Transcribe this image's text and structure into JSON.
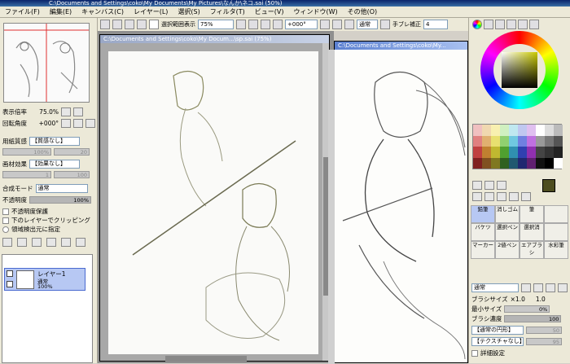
{
  "window": {
    "title": "C:\\Documents and Settings\\coko\\My Documents\\My Pictures\\なんか\\ネコ.sai (50%)"
  },
  "menu": [
    "ファイル(F)",
    "編集(E)",
    "キャンバス(C)",
    "レイヤー(L)",
    "選択(S)",
    "フィルタ(T)",
    "ビュー(V)",
    "ウィンドウ(W)",
    "その他(O)"
  ],
  "toolbar": {
    "selection_label": "選択範囲表示",
    "zoom": "75%",
    "rotation": "+000°",
    "blend": "通常",
    "stabilizer_label": "手ブレ補正",
    "stabilizer": "4"
  },
  "left": {
    "zoom_label": "表示倍率",
    "zoom_value": "75.0%",
    "angle_label": "回転角度",
    "angle_value": "+000°",
    "paper_label": "用紙質感",
    "paper_value": "【質感なし】",
    "paper_scale": "100%",
    "paper_amt": "20",
    "effect_label": "画材効果",
    "effect_value": "【効果なし】",
    "effect_amt1": "1",
    "effect_amt2": "100",
    "mode_label": "合成モード",
    "mode_value": "通常",
    "opacity_label": "不透明度",
    "opacity_value": "100%",
    "check1": "不透明度保護",
    "check2": "下のレイヤーでクリッピング",
    "check3": "領域検出元に指定",
    "layer_name": "レイヤー1",
    "layer_mode": "通常",
    "layer_opacity": "100%"
  },
  "doc1": {
    "title": "C:\\Documents and Settings\\coko\\My Docum...\\sp.sai (75%)"
  },
  "doc2": {
    "title": "C:\\Documents and Settings\\coko\\My..."
  },
  "right": {
    "tools": [
      "鉛筆",
      "消しゴム",
      "筆",
      "",
      "バケツ",
      "選択ペン",
      "選択消",
      "",
      "マーカー",
      "2値ペン",
      "エアブラシ",
      "水彩筆"
    ],
    "blend": "通常",
    "size_label": "ブラシサイズ",
    "size_mult": "×1.0",
    "size_value": "1.0",
    "min_label": "最小サイズ",
    "min_value": "0%",
    "density_label": "ブラシ濃度",
    "density_value": "100",
    "shape": "【通常の円形】",
    "shape_v": "50",
    "texture": "【テクスチャなし】",
    "texture_v": "95",
    "detail": "詳細設定"
  },
  "colors": {
    "accent": "#3a6ea5",
    "current": "#4d4d1f"
  }
}
